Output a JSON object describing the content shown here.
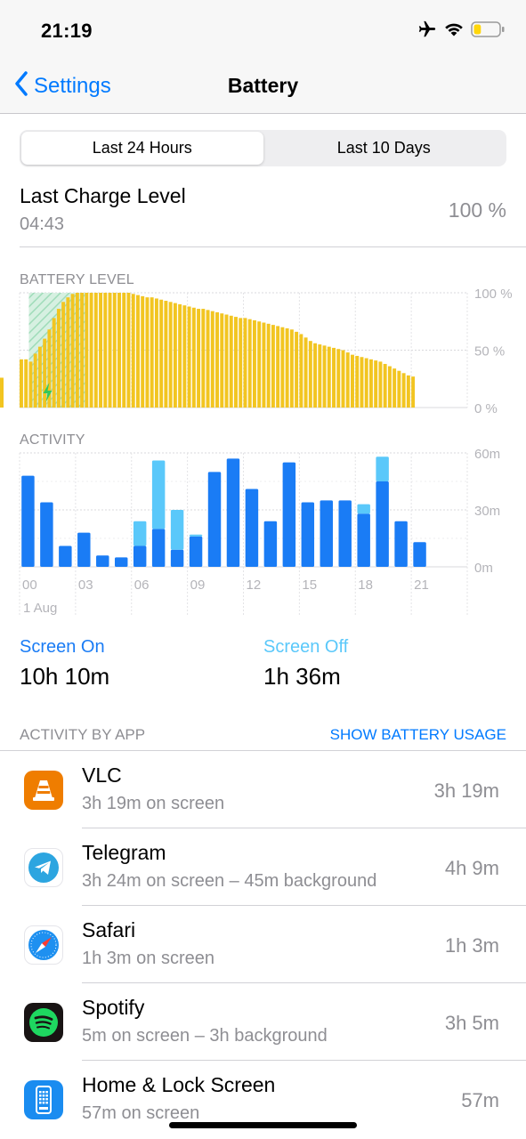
{
  "status_bar": {
    "time": "21:19",
    "icons": [
      "airplane-icon",
      "wifi-icon",
      "battery-icon"
    ],
    "battery_level": 0.25,
    "battery_color": "#ffd60a"
  },
  "nav": {
    "back_label": "Settings",
    "title": "Battery"
  },
  "segments": [
    {
      "label": "Last 24 Hours",
      "active": true
    },
    {
      "label": "Last 10 Days",
      "active": false
    }
  ],
  "last_charge": {
    "title": "Last Charge Level",
    "time": "04:43",
    "value": "100 %"
  },
  "battery_chart_label": "BATTERY LEVEL",
  "activity_chart_label": "ACTIVITY",
  "summary": {
    "screen_on_label": "Screen On",
    "screen_on_value": "10h 10m",
    "screen_off_label": "Screen Off",
    "screen_off_value": "1h 36m"
  },
  "apps_header": {
    "title": "ACTIVITY BY APP",
    "action": "SHOW BATTERY USAGE"
  },
  "apps": [
    {
      "name": "VLC",
      "detail": "3h 19m on screen",
      "time": "3h 19m",
      "icon": "vlc-icon"
    },
    {
      "name": "Telegram",
      "detail": "3h 24m on screen – 45m background",
      "time": "4h 9m",
      "icon": "telegram-icon"
    },
    {
      "name": "Safari",
      "detail": "1h 3m on screen",
      "time": "1h 3m",
      "icon": "safari-icon"
    },
    {
      "name": "Spotify",
      "detail": "5m on screen – 3h background",
      "time": "3h 5m",
      "icon": "spotify-icon"
    },
    {
      "name": "Home & Lock Screen",
      "detail": "57m on screen",
      "time": "57m",
      "icon": "home-lock-screen-icon"
    }
  ],
  "colors": {
    "accent": "#007aff",
    "screen_on": "#1a7cf5",
    "screen_off": "#5ac8fa",
    "battery_bar": "#f2c521",
    "charging_fill": "#cfeedd",
    "charging_icon": "#34c759"
  },
  "chart_data": [
    {
      "type": "bar",
      "title": "BATTERY LEVEL",
      "ylim": [
        0,
        100
      ],
      "y_ticks": [
        "100 %",
        "50 %",
        "0 %"
      ],
      "charging_window": [
        0.5,
        3.5
      ],
      "x": [
        0.0,
        0.25,
        0.5,
        0.75,
        1.0,
        1.25,
        1.5,
        1.75,
        2.0,
        2.25,
        2.5,
        2.75,
        3.0,
        3.25,
        3.5,
        3.75,
        4.0,
        4.25,
        4.5,
        4.75,
        5.0,
        5.25,
        5.5,
        5.75,
        6.0,
        6.25,
        6.5,
        6.75,
        7.0,
        7.25,
        7.5,
        7.75,
        8.0,
        8.25,
        8.5,
        8.75,
        9.0,
        9.25,
        9.5,
        9.75,
        10.0,
        10.25,
        10.5,
        10.75,
        11.0,
        11.25,
        11.5,
        11.75,
        12.0,
        12.25,
        12.5,
        12.75,
        13.0,
        13.25,
        13.5,
        13.75,
        14.0,
        14.25,
        14.5,
        14.75,
        15.0,
        15.25,
        15.5,
        15.75,
        16.0,
        16.25,
        16.5,
        16.75,
        17.0,
        17.25,
        17.5,
        17.75,
        18.0,
        18.25,
        18.5,
        18.75,
        19.0,
        19.25,
        19.5,
        19.75,
        20.0,
        20.25,
        20.5,
        20.75,
        21.0
      ],
      "values": [
        42,
        42,
        40,
        47,
        53,
        60,
        68,
        78,
        86,
        92,
        96,
        99,
        100,
        100,
        100,
        100,
        100,
        100,
        100,
        100,
        100,
        100,
        100,
        100,
        99,
        98,
        97,
        96,
        96,
        95,
        94,
        93,
        92,
        91,
        90,
        89,
        88,
        87,
        86,
        86,
        85,
        84,
        83,
        82,
        81,
        80,
        79,
        78,
        78,
        77,
        76,
        75,
        74,
        73,
        72,
        71,
        70,
        69,
        68,
        66,
        64,
        61,
        58,
        56,
        55,
        54,
        53,
        52,
        51,
        50,
        48,
        46,
        45,
        44,
        43,
        42,
        41,
        40,
        38,
        36,
        34,
        32,
        30,
        28,
        27,
        26,
        25,
        24,
        24
      ]
    },
    {
      "type": "bar",
      "title": "ACTIVITY",
      "ylim": [
        0,
        60
      ],
      "y_ticks": [
        "60m",
        "30m",
        "0m"
      ],
      "x_ticks": [
        "00",
        "03",
        "06",
        "09",
        "12",
        "15",
        "18",
        "21"
      ],
      "x_sublabel": "1 Aug",
      "x": [
        0,
        1,
        2,
        3,
        4,
        5,
        6,
        7,
        8,
        9,
        10,
        11,
        12,
        13,
        14,
        15,
        16,
        17,
        18,
        19,
        20,
        21
      ],
      "series": [
        {
          "name": "Screen On",
          "values": [
            48,
            34,
            11,
            18,
            6,
            5,
            11,
            20,
            9,
            16,
            50,
            57,
            41,
            24,
            55,
            34,
            35,
            35,
            28,
            45,
            24,
            13
          ]
        },
        {
          "name": "Screen Off",
          "values": [
            0,
            0,
            0,
            0,
            0,
            0,
            13,
            36,
            21,
            1,
            0,
            0,
            0,
            0,
            0,
            0,
            0,
            0,
            5,
            13,
            0,
            0
          ]
        }
      ]
    }
  ]
}
